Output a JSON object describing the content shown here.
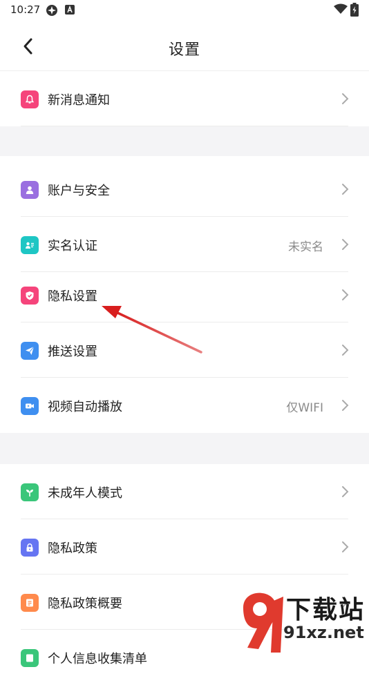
{
  "status_bar": {
    "time": "10:27"
  },
  "header": {
    "title": "设置"
  },
  "groups": [
    {
      "items": [
        {
          "label": "新消息通知",
          "value": ""
        }
      ]
    },
    {
      "items": [
        {
          "label": "账户与安全",
          "value": ""
        },
        {
          "label": "实名认证",
          "value": "未实名"
        },
        {
          "label": "隐私设置",
          "value": ""
        },
        {
          "label": "推送设置",
          "value": ""
        },
        {
          "label": "视频自动播放",
          "value": "仅WIFI"
        }
      ]
    },
    {
      "items": [
        {
          "label": "未成年人模式",
          "value": ""
        },
        {
          "label": "隐私政策",
          "value": ""
        },
        {
          "label": "隐私政策概要",
          "value": ""
        },
        {
          "label": "个人信息收集清单",
          "value": ""
        }
      ]
    }
  ],
  "icon_colors": {
    "notify": "#f5447b",
    "account": "#9a6fe0",
    "realname": "#1ec6c4",
    "privacy": "#f5447b",
    "push": "#3f8ff0",
    "video": "#3f8ff0",
    "minor": "#3ac67a",
    "policy": "#6675f2",
    "summary": "#ff8a4c",
    "collect": "#3ac67a"
  },
  "annotation_color": "#d81e1e",
  "watermark": {
    "site_name": "下载站",
    "url": "91xz.net"
  }
}
